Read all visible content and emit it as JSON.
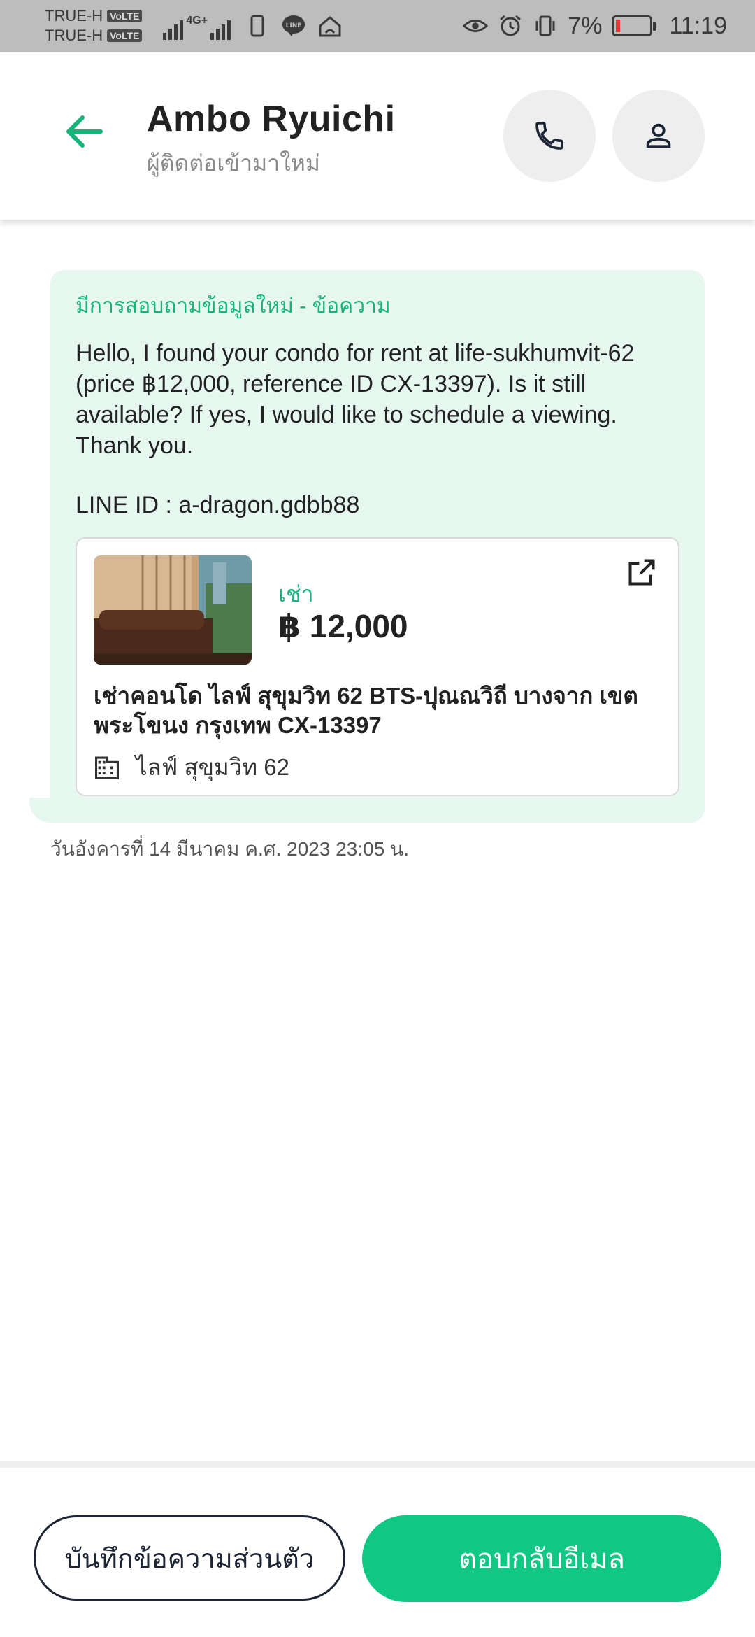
{
  "status_bar": {
    "carrier_1": "TRUE-H",
    "carrier_2": "TRUE-H",
    "volte_badge": "VoLTE",
    "network": "4G+",
    "battery_percent": "7%",
    "time": "11:19",
    "battery_level": 0.07
  },
  "header": {
    "name": "Ambo Ryuichi",
    "subtitle": "ผู้ติดต่อเข้ามาใหม่",
    "icons": {
      "back": "arrow-left-icon",
      "call": "phone-icon",
      "profile": "person-icon"
    }
  },
  "message": {
    "heading": "มีการสอบถามข้อมูลใหม่ - ข้อความ",
    "body": "Hello, I found your condo for rent at life-sukhumvit-62 (price ฿12,000, reference ID CX-13397). Is it still available? If yes, I would like to schedule a viewing. Thank you.",
    "line_id": "LINE ID : a-dragon.gdbb88",
    "listing": {
      "type": "เช่า",
      "price": "฿ 12,000",
      "title": "เช่าคอนโด  ไลฟ์ สุขุมวิท 62 BTS-ปุณณวิถี บางจาก เขต พระโขนง กรุงเทพ CX-13397",
      "building": "ไลฟ์ สุขุมวิท 62"
    },
    "timestamp": "วันอังคารที่ 14 มีนาคม ค.ศ. 2023 23:05 น."
  },
  "footer": {
    "private_note_label": "บันทึกข้อความส่วนตัว",
    "reply_email_label": "ตอบกลับอีเมล"
  },
  "colors": {
    "accent": "#10c783",
    "bubble_bg": "#e6f7f0",
    "status_bar_bg": "#bdbdbd"
  }
}
